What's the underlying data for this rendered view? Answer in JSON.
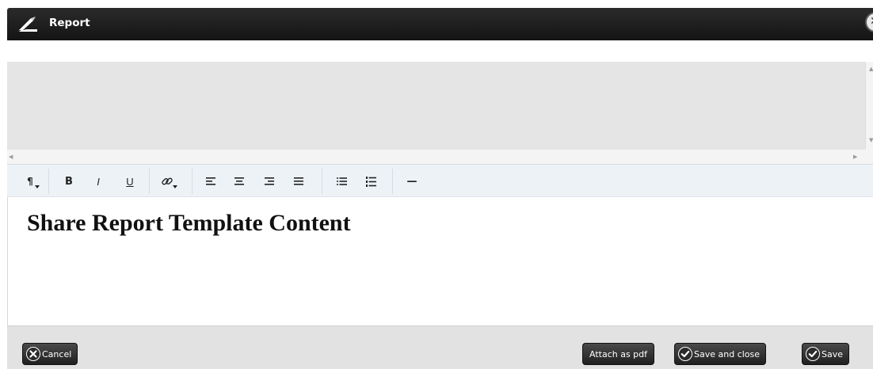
{
  "dialog": {
    "title": "Report",
    "close_glyph": "✕",
    "title_icon": "pen-nib-icon"
  },
  "scrollbars": {
    "up_glyph": "▲",
    "down_glyph": "▼",
    "left_glyph": "◀",
    "right_glyph": "▶"
  },
  "toolbar": {
    "paragraph": "¶",
    "bold": "B",
    "italic": "I",
    "underline": "U",
    "hr": "—"
  },
  "editor": {
    "heading": "Share Report Template Content"
  },
  "footer": {
    "cancel_label": "Cancel",
    "attach_pdf_label": "Attach as pdf",
    "save_close_label": "Save and close",
    "save_label": "Save"
  },
  "colors": {
    "titlebar": "#1a1a1a",
    "preview_bg": "#e5e5e5",
    "toolbar_bg": "#edf2f6",
    "footer_bg": "#e2e2e2",
    "button_bg": "#2e2e2e"
  }
}
